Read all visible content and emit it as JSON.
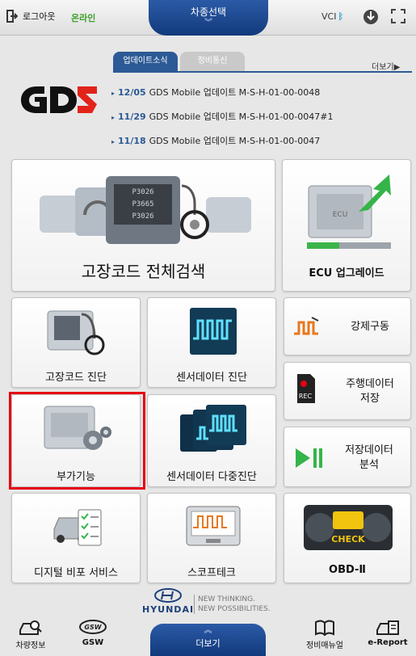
{
  "topbar": {
    "logout_label": "로그아웃",
    "status_label": "온라인",
    "car_select_label": "차종선택",
    "vci_label": "VCI",
    "icons": [
      "logout-icon",
      "bluetooth-icon",
      "download-icon",
      "fullscreen-icon"
    ]
  },
  "news": {
    "tabs": [
      "업데이트소식",
      "정비통신"
    ],
    "more_label": "더보기▶",
    "items": [
      {
        "date": "12/05",
        "text": "GDS Mobile 업데이트 M-S-H-01-00-0048"
      },
      {
        "date": "11/29",
        "text": "GDS Mobile 업데이트 M-S-H-01-00-0047#1"
      },
      {
        "date": "11/18",
        "text": "GDS Mobile 업데이트 M-S-H-01-00-0047"
      }
    ]
  },
  "tiles": {
    "dtc_search": "고장코드 전체검색",
    "dtc_codes": [
      "P3026",
      "P3665",
      "P3026"
    ],
    "ecu_upgrade": "ECU 업그레이드",
    "ecu_text": "ECU",
    "dtc_diag": "고장코드 진단",
    "sensor_diag": "센서데이터 진단",
    "actuation": "강제구동",
    "drive_record_1": "주행데이터",
    "drive_record_2": "저장",
    "rec_label": "REC",
    "addon": "부가기능",
    "sensor_multi": "센서데이터 다중진단",
    "saved_analysis_1": "저장데이터",
    "saved_analysis_2": "분석",
    "digital_service": "디지털 비포 서비스",
    "scope": "스코프테크",
    "obd": "OBD-Ⅱ",
    "check_text": "CHECK"
  },
  "brand": {
    "name": "HYUNDAI",
    "slogan_1": "NEW THINKING.",
    "slogan_2": "NEW POSSIBILITIES."
  },
  "bottom": {
    "vehicle_info": "차량정보",
    "gsw": "GSW",
    "gsw_logo": "GSW",
    "more": "더보기",
    "manual": "정비매뉴얼",
    "ereport": "e-Report"
  },
  "colors": {
    "accent_blue": "#2c5a96",
    "online_green": "#3da02c",
    "highlight_red": "#e60012",
    "gds_red": "#e2231a"
  }
}
